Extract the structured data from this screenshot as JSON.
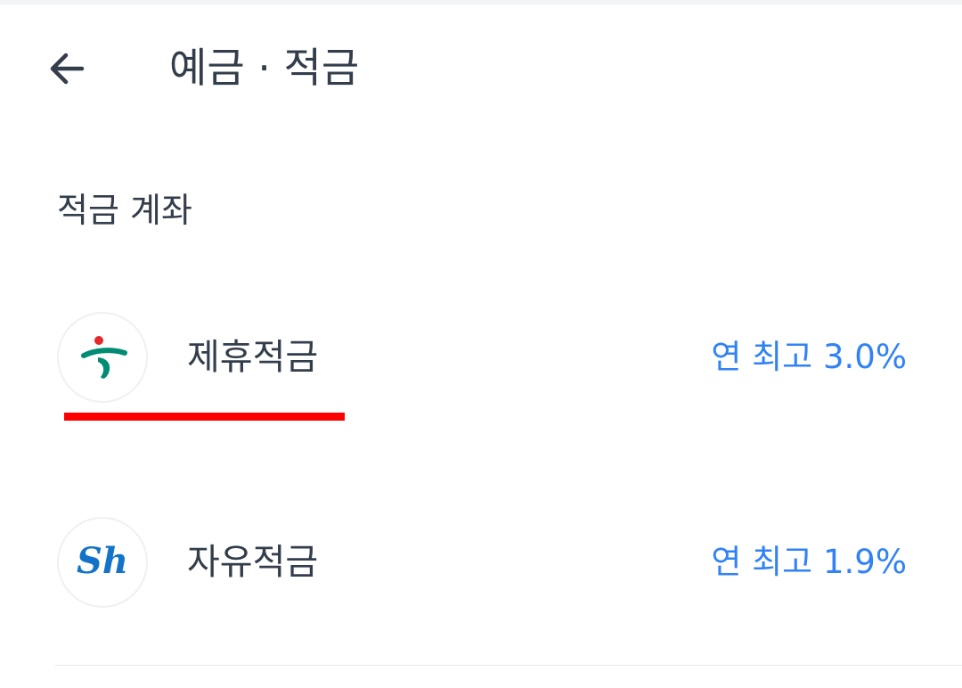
{
  "header": {
    "title": "예금 · 적금",
    "back_icon": "arrow-left-icon"
  },
  "section": {
    "title": "적금 계좌"
  },
  "products": [
    {
      "name": "제휴적금",
      "rate": "연 최고 3.0%",
      "logo_icon": "hana-bank-logo-icon",
      "logo_colors": {
        "green": "#008c73",
        "red": "#e6282d"
      }
    },
    {
      "name": "자유적금",
      "rate": "연 최고 1.9%",
      "logo_icon": "sh-bank-logo-icon",
      "logo_text": "Sh",
      "logo_colors": {
        "blue": "#1273c7"
      }
    }
  ],
  "colors": {
    "accent_blue": "#3182f6",
    "text_primary": "#333d4b",
    "highlight_red": "#ff0000"
  }
}
